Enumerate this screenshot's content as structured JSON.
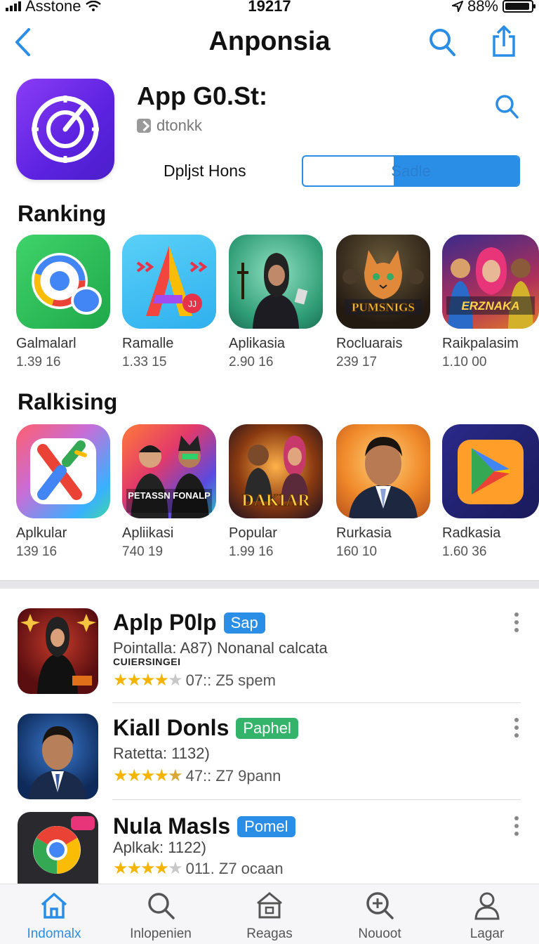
{
  "status_bar": {
    "carrier": "Asstone",
    "time": "19217",
    "battery": "88%"
  },
  "nav": {
    "title": "Anponsia"
  },
  "app": {
    "name": "App G0.St:",
    "developer": "dtonkk",
    "subtitle": "Dpljst Hons",
    "action_label": "Sadle",
    "action_progress": 0.42
  },
  "ranking": {
    "title": "Ranking",
    "items": [
      {
        "name": "Galmalarl",
        "meta": "1.39 16",
        "icon": "chat-bubble-icon"
      },
      {
        "name": "Ramalle",
        "meta": "1.33 15",
        "icon": "letter-a-icon"
      },
      {
        "name": "Aplikasia",
        "meta": "2.90 16",
        "icon": "person-hijab-image"
      },
      {
        "name": "Rocluarais",
        "meta": "239 17",
        "icon": "cat-game-image",
        "art_text": "PUMSNIGS"
      },
      {
        "name": "Raikpalasim",
        "meta": "1.10 00",
        "icon": "group-poster-image",
        "art_text": "ERZNAKA"
      }
    ]
  },
  "ralkising": {
    "title": "Ralkising",
    "items": [
      {
        "name": "Aplkular",
        "meta": "139 16",
        "icon": "x-logo-icon"
      },
      {
        "name": "Apliikasi",
        "meta": "740 19",
        "icon": "poster-men-image",
        "art_text": "PETASSN FONALP"
      },
      {
        "name": "Popular",
        "meta": "1.99 16",
        "icon": "movie-poster-image",
        "art_text": "DAKIAR"
      },
      {
        "name": "Rurkasia",
        "meta": "160 10",
        "icon": "man-portrait-image"
      },
      {
        "name": "Radkasia",
        "meta": "1.60 36",
        "icon": "play-triangle-icon"
      }
    ]
  },
  "list": [
    {
      "title": "Aplp P0lp",
      "badge": "Sap",
      "badge_color": "#2a8ee6",
      "line2": "Pointalla: A87) Nonanal calcata",
      "line3": "CUIERSINGEI",
      "rating_text": "07:: Z5 spem",
      "stars": 4
    },
    {
      "title": "Kiall Donls",
      "badge": "Paphel",
      "badge_color": "#34b36a",
      "line2": "Ratetta: 1132)",
      "line3": "",
      "rating_text": "47:: Z7 9pann",
      "stars": 4.5
    },
    {
      "title": "Nula Masls",
      "badge": "Pomel",
      "badge_color": "#2a8ee6",
      "line2": "Aplkak: 1122)",
      "line3": "",
      "rating_text": "011. Z7 ocaan",
      "stars": 4
    }
  ],
  "tabs": [
    {
      "label": "Indomalx",
      "icon": "home-icon",
      "active": true
    },
    {
      "label": "Inlopenien",
      "icon": "search-icon",
      "active": false
    },
    {
      "label": "Reagas",
      "icon": "store-icon",
      "active": false
    },
    {
      "label": "Nouoot",
      "icon": "zoom-plus-icon",
      "active": false
    },
    {
      "label": "Lagar",
      "icon": "person-icon",
      "active": false
    }
  ],
  "colors": {
    "accent": "#2a8ee6",
    "star": "#f4b400"
  }
}
